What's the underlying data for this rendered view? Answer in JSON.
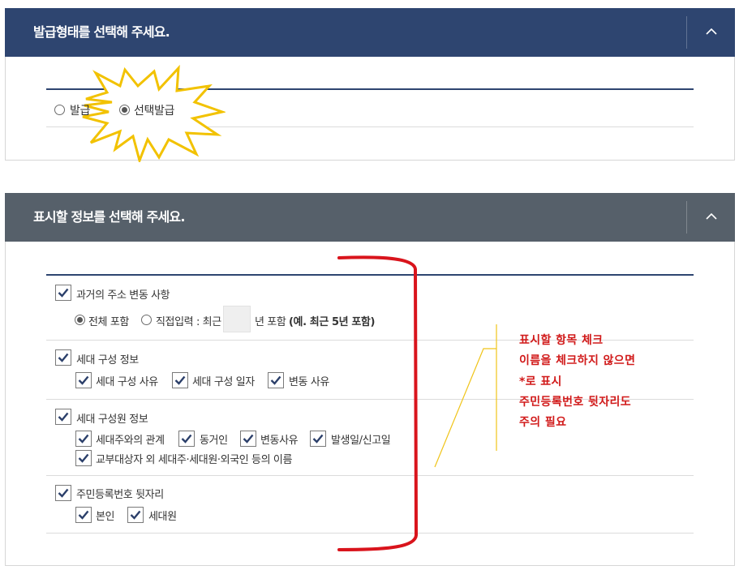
{
  "section1": {
    "title": "발급형태를 선택해 주세요.",
    "options": [
      {
        "label": "발급",
        "selected": false
      },
      {
        "label": "선택발급",
        "selected": true
      }
    ]
  },
  "section2": {
    "title": "표시할 정보를 선택해 주세요.",
    "groups": [
      {
        "label": "과거의 주소 변동 사항",
        "checked": true,
        "radio_all": "전체 포함",
        "radio_direct": "직접입력 : 최근",
        "year_suffix": "년 포함",
        "example": "(예. 최근 5년 포함)"
      },
      {
        "label": "세대 구성 정보",
        "checked": true,
        "items": [
          "세대 구성 사유",
          "세대 구성 일자",
          "변동 사유"
        ]
      },
      {
        "label": "세대 구성원 정보",
        "checked": true,
        "items": [
          "세대주와의 관계",
          "동거인",
          "변동사유",
          "발생일/신고일",
          "교부대상자 외 세대주·세대원·외국인 등의 이름"
        ]
      },
      {
        "label": "주민등록번호 뒷자리",
        "checked": true,
        "items": [
          "본인",
          "세대원"
        ]
      }
    ]
  },
  "annotation": {
    "lines": [
      "표시할 항목 체크",
      "이름을 체크하지 않으면",
      "*로 표시",
      "주민등록번호 뒷자리도",
      "주의 필요"
    ]
  },
  "colors": {
    "header1": "#2e4570",
    "header2": "#56606a",
    "accent_check": "#2b3f6a",
    "starburst_stroke": "#f2c200",
    "bracket": "#d9141c",
    "note_text": "#d11a1a",
    "leader_line": "#f0c419"
  },
  "icons": {
    "toggle": "chevron-up-icon",
    "checkbox": "checkmark-icon",
    "highlight": "starburst-icon"
  }
}
